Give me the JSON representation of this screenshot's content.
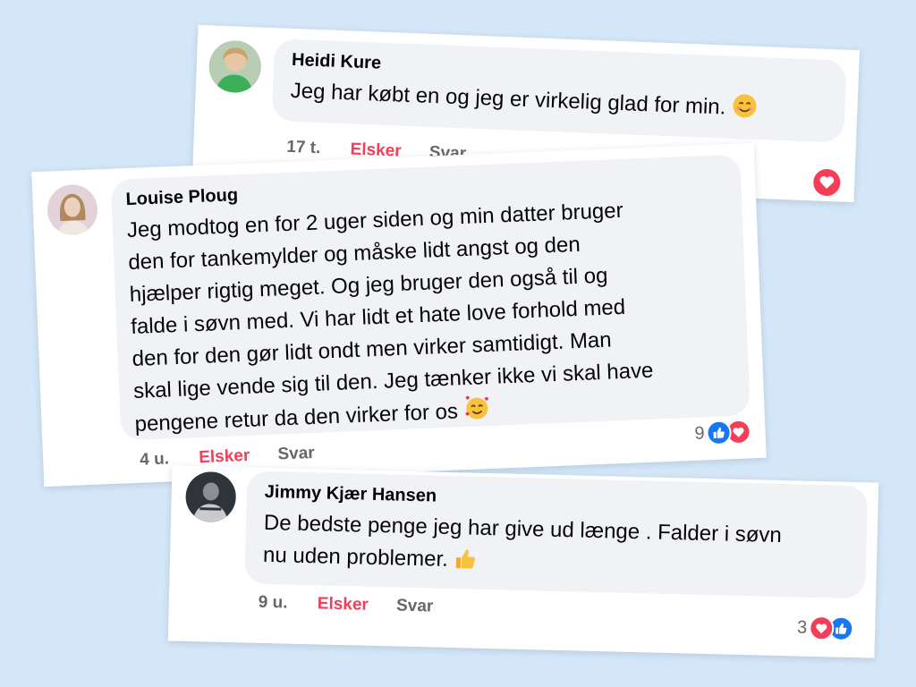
{
  "comments": [
    {
      "author": "Heidi Kure",
      "lines": [
        "Jeg har købt en og jeg er virkelig glad for min."
      ],
      "emoji": "smiling-face-emoji",
      "time": "17 t.",
      "love_label": "Elsker",
      "reply_label": "Svar",
      "reaction_count": "",
      "reactions": [
        "heart"
      ]
    },
    {
      "author": "Louise Ploug",
      "lines": [
        "Jeg modtog en for 2 uger siden og min datter bruger",
        "den for tankemylder og måske lidt angst og den",
        "hjælper rigtig meget. Og jeg bruger den også til og",
        "falde i søvn med. Vi har lidt et hate love forhold med",
        "den for den gør lidt ondt men virker samtidigt. Man",
        "skal lige vende sig til den. Jeg tænker ikke vi skal have",
        "pengene retur da den virker for os"
      ],
      "emoji": "smiling-face-with-hearts-emoji",
      "time": "4 u.",
      "love_label": "Elsker",
      "reply_label": "Svar",
      "reaction_count": "9",
      "reactions": [
        "like",
        "heart"
      ]
    },
    {
      "author": "Jimmy Kjær Hansen",
      "lines": [
        "De bedste penge jeg har give ud længe  . Falder i søvn",
        "nu uden problemer."
      ],
      "emoji": "thumbs-up-emoji",
      "time": "9 u.",
      "love_label": "Elsker",
      "reply_label": "Svar",
      "reaction_count": "3",
      "reactions": [
        "heart",
        "like"
      ]
    }
  ],
  "colors": {
    "background": "#d4e7f8",
    "bubble": "#f0f2f5",
    "love": "#f33e58",
    "like": "#1877f2",
    "meta": "#65676b"
  }
}
